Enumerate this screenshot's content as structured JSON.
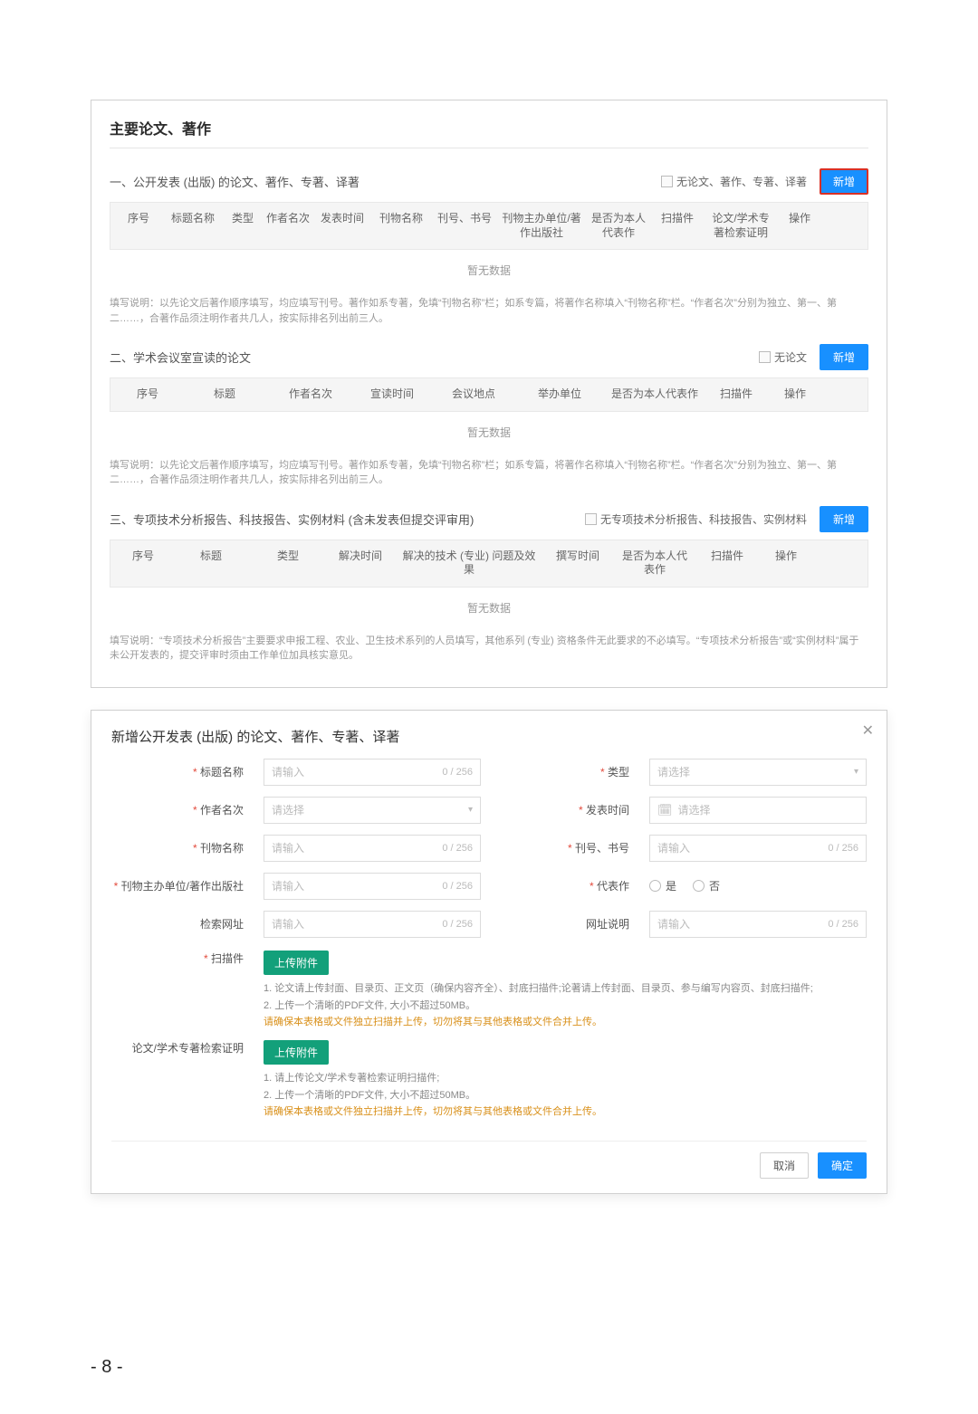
{
  "panel": {
    "title": "主要论文、著作",
    "sec1": {
      "heading": "一、公开发表 (出版) 的论文、著作、专著、译著",
      "none_label": "无论文、著作、专著、译著",
      "add_btn": "新增",
      "cols": [
        "序号",
        "标题名称",
        "类型",
        "作者名次",
        "发表时间",
        "刊物名称",
        "刊号、书号",
        "刊物主办单位/著作出版社",
        "是否为本人代表作",
        "扫描件",
        "论文/学术专著检索证明",
        "操作"
      ],
      "no_data": "暂无数据",
      "footnote": "填写说明：以先论文后著作顺序填写，均应填写刊号。著作如系专著，免填“刊物名称”栏；如系专篇，将著作名称填入“刊物名称”栏。“作者名次”分别为独立、第一、第二……，合著作品须注明作者共几人，按实际排名列出前三人。"
    },
    "sec2": {
      "heading": "二、学术会议室宣读的论文",
      "none_label": "无论文",
      "add_btn": "新增",
      "cols": [
        "序号",
        "标题",
        "作者名次",
        "宣读时间",
        "会议地点",
        "举办单位",
        "是否为本人代表作",
        "扫描件",
        "操作"
      ],
      "no_data": "暂无数据",
      "footnote": "填写说明：以先论文后著作顺序填写，均应填写刊号。著作如系专著，免填“刊物名称”栏；如系专篇，将著作名称填入“刊物名称”栏。“作者名次”分别为独立、第一、第二……，合著作品须注明作者共几人，按实际排名列出前三人。"
    },
    "sec3": {
      "heading": "三、专项技术分析报告、科技报告、实例材料 (含未发表但提交评审用)",
      "none_label": "无专项技术分析报告、科技报告、实例材料",
      "add_btn": "新增",
      "cols": [
        "序号",
        "标题",
        "类型",
        "解决时间",
        "解决的技术 (专业) 问题及效果",
        "撰写时间",
        "是否为本人代表作",
        "扫描件",
        "操作"
      ],
      "no_data": "暂无数据",
      "footnote": "填写说明：“专项技术分析报告”主要要求申报工程、农业、卫生技术系列的人员填写，其他系列 (专业) 资格条件无此要求的不必填写。“专项技术分析报告”或“实例材料”属于未公开发表的，提交评审时须由工作单位加具核实意见。"
    }
  },
  "modal": {
    "title": "新增公开发表 (出版) 的论文、著作、专著、译著",
    "close": "✕",
    "fields": {
      "title_name_lbl": "标题名称",
      "type_lbl": "类型",
      "author_rank_lbl": "作者名次",
      "publish_time_lbl": "发表时间",
      "journal_name_lbl": "刊物名称",
      "issn_lbl": "刊号、书号",
      "publisher_lbl": "刊物主办单位/著作出版社",
      "represent_lbl": "代表作",
      "search_url_lbl": "检索网址",
      "url_note_lbl": "网址说明",
      "scan_lbl": "扫描件",
      "index_proof_lbl": "论文/学术专著检索证明"
    },
    "placeholders": {
      "input": "请输入",
      "select": "请选择"
    },
    "counter": "0 / 256",
    "radio_yes": "是",
    "radio_no": "否",
    "upload_btn": "上传附件",
    "scan_notes_1": "1. 论文请上传封面、目录页、正文页（确保内容齐全）、封底扫描件;论著请上传封面、目录页、参与编写内容页、封底扫描件;",
    "scan_notes_2": "2. 上传一个清晰的PDF文件, 大小不超过50MB。",
    "scan_notes_warn": "请确保本表格或文件独立扫描并上传，切勿将其与其他表格或文件合并上传。",
    "proof_notes_1": "1. 请上传论文/学术专著检索证明扫描件;",
    "proof_notes_2": "2. 上传一个清晰的PDF文件, 大小不超过50MB。",
    "cancel": "取消",
    "ok": "确定"
  },
  "page_number": "- 8 -"
}
